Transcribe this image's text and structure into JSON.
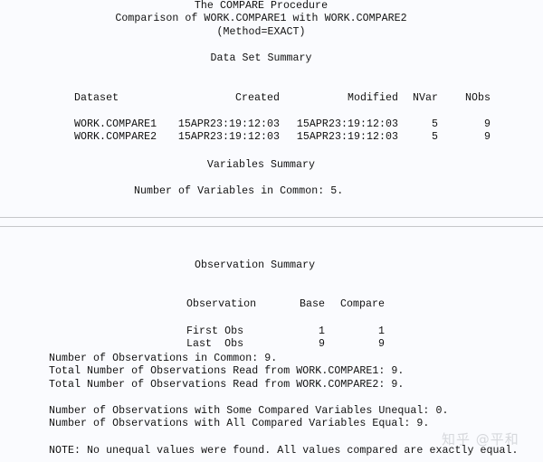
{
  "header": {
    "title": "The COMPARE Procedure",
    "subtitle": "Comparison of WORK.COMPARE1 with WORK.COMPARE2",
    "method": "(Method=EXACT)"
  },
  "dataset_summary": {
    "title": "Data Set Summary",
    "columns": [
      "Dataset",
      "Created",
      "Modified",
      "NVar",
      "NObs"
    ],
    "rows": [
      {
        "dataset": "WORK.COMPARE1",
        "created": "15APR23:19:12:03",
        "modified": "15APR23:19:12:03",
        "nvar": "5",
        "nobs": "9"
      },
      {
        "dataset": "WORK.COMPARE2",
        "created": "15APR23:19:12:03",
        "modified": "15APR23:19:12:03",
        "nvar": "5",
        "nobs": "9"
      }
    ]
  },
  "variables_summary": {
    "title": "Variables Summary",
    "common": "Number of Variables in Common: 5."
  },
  "observation_summary": {
    "title": "Observation Summary",
    "columns": [
      "Observation",
      "Base",
      "Compare"
    ],
    "rows": [
      {
        "label": "First Obs",
        "base": "1",
        "compare": "1"
      },
      {
        "label": "Last  Obs",
        "base": "9",
        "compare": "9"
      }
    ]
  },
  "stats": [
    "Number of Observations in Common: 9.",
    "Total Number of Observations Read from WORK.COMPARE1: 9.",
    "Total Number of Observations Read from WORK.COMPARE2: 9."
  ],
  "equality": [
    "Number of Observations with Some Compared Variables Unequal: 0.",
    "Number of Observations with All Compared Variables Equal: 9."
  ],
  "note": "NOTE: No unequal values were found. All values compared are exactly equal.",
  "watermark": "知乎 @平和"
}
